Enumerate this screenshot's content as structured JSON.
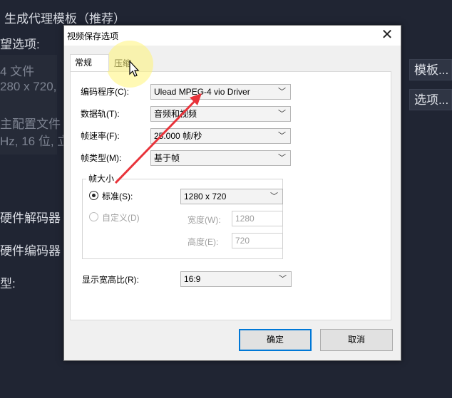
{
  "background": {
    "title": "生成代理模板（推荐）",
    "options_label": "望选项:",
    "file_line1": "4 文件",
    "file_line2": "280 x 720,",
    "config_line1": "主配置文件",
    "config_line2": "Hz, 16 位, 立",
    "hw_decoder": "硬件解码器",
    "hw_encoder": "硬件编码器",
    "type_label": "型:",
    "template_button": "模板...",
    "options_button": "选项..."
  },
  "dialog": {
    "title": "视频保存选项",
    "close_glyph": "✕",
    "tabs": [
      "常规",
      "压缩"
    ],
    "fields": {
      "codec_label": "编码程序(C):",
      "codec_value": "Ulead MPEG-4 vio Driver",
      "tracks_label": "数据轨(T):",
      "tracks_value": "音频和视频",
      "framerate_label": "帧速率(F):",
      "framerate_value": "25.000 帧/秒",
      "frametype_label": "帧类型(M):",
      "frametype_value": "基于帧"
    },
    "framesize": {
      "group_title": "帧大小",
      "standard_label": "标准(S):",
      "standard_value": "1280 x 720",
      "custom_label": "自定义(D)",
      "width_label": "宽度(W):",
      "width_value": "1280",
      "height_label": "高度(E):",
      "height_value": "720"
    },
    "aspect_label": "显示宽高比(R):",
    "aspect_value": "16:9",
    "ok_button": "确定",
    "cancel_button": "取消"
  },
  "colors": {
    "background": "#202533",
    "accent_arrow": "#e8333a",
    "default_button_border": "#0078d7",
    "highlight": "#fff478"
  }
}
